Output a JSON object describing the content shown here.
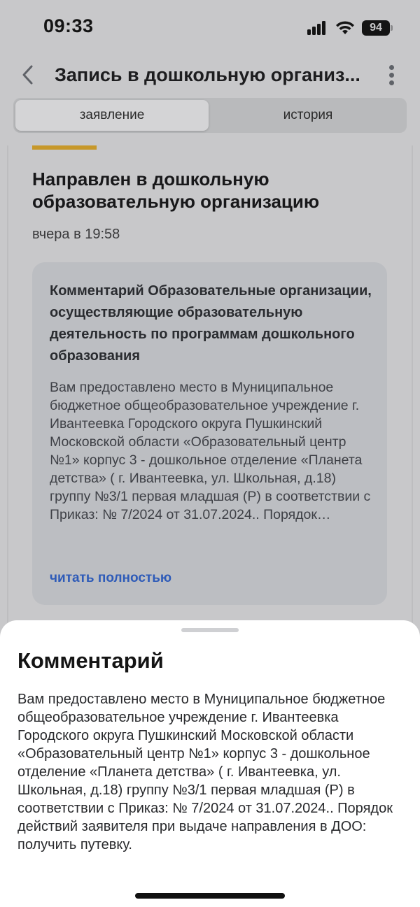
{
  "status_bar": {
    "time": "09:33",
    "battery": "94"
  },
  "header": {
    "title": "Запись в дошкольную организ...",
    "back_icon": "chevron-left-icon",
    "more_icon": "vertical-ellipsis-icon"
  },
  "tabs": [
    {
      "label": "заявление",
      "active": true
    },
    {
      "label": "история",
      "active": false
    }
  ],
  "status_card": {
    "title": "Направлен в дошкольную образовательную организацию",
    "time": "вчера в 19:58",
    "accent_color": "#c7982a"
  },
  "comment_preview": {
    "heading": "Комментарий Образовательные организации, осуществляющие образовательную деятельность по программам дошкольного образования",
    "text": "Вам предоставлено место в Муниципальное бюджетное общеобразовательное учреждение г. Ивантеевка Городского округа Пушкинский Московской области «Образовательный центр №1» корпус 3 - дошкольное отделение «Планета детства» ( г. Ивантеевка, ул. Школьная, д.18) группу №3/1 первая младшая (Р) в соответствии с Приказ: № 7/2024 от 31.07.2024.. Порядок…",
    "read_more": "читать полностью",
    "link_color": "#2e5bb8"
  },
  "sheet": {
    "title": "Комментарий",
    "body": "Вам предоставлено место в Муниципальное бюджетное общеобразовательное учреждение г. Ивантеевка Городского округа Пушкинский Московской области «Образовательный центр №1» корпус 3 - дошкольное отделение «Планета детства» ( г. Ивантеевка, ул. Школьная, д.18) группу №3/1 первая младшая (Р) в соответствии с Приказ: № 7/2024 от 31.07.2024.. Порядок действий заявителя при выдаче направления в ДОО: получить путевку."
  }
}
